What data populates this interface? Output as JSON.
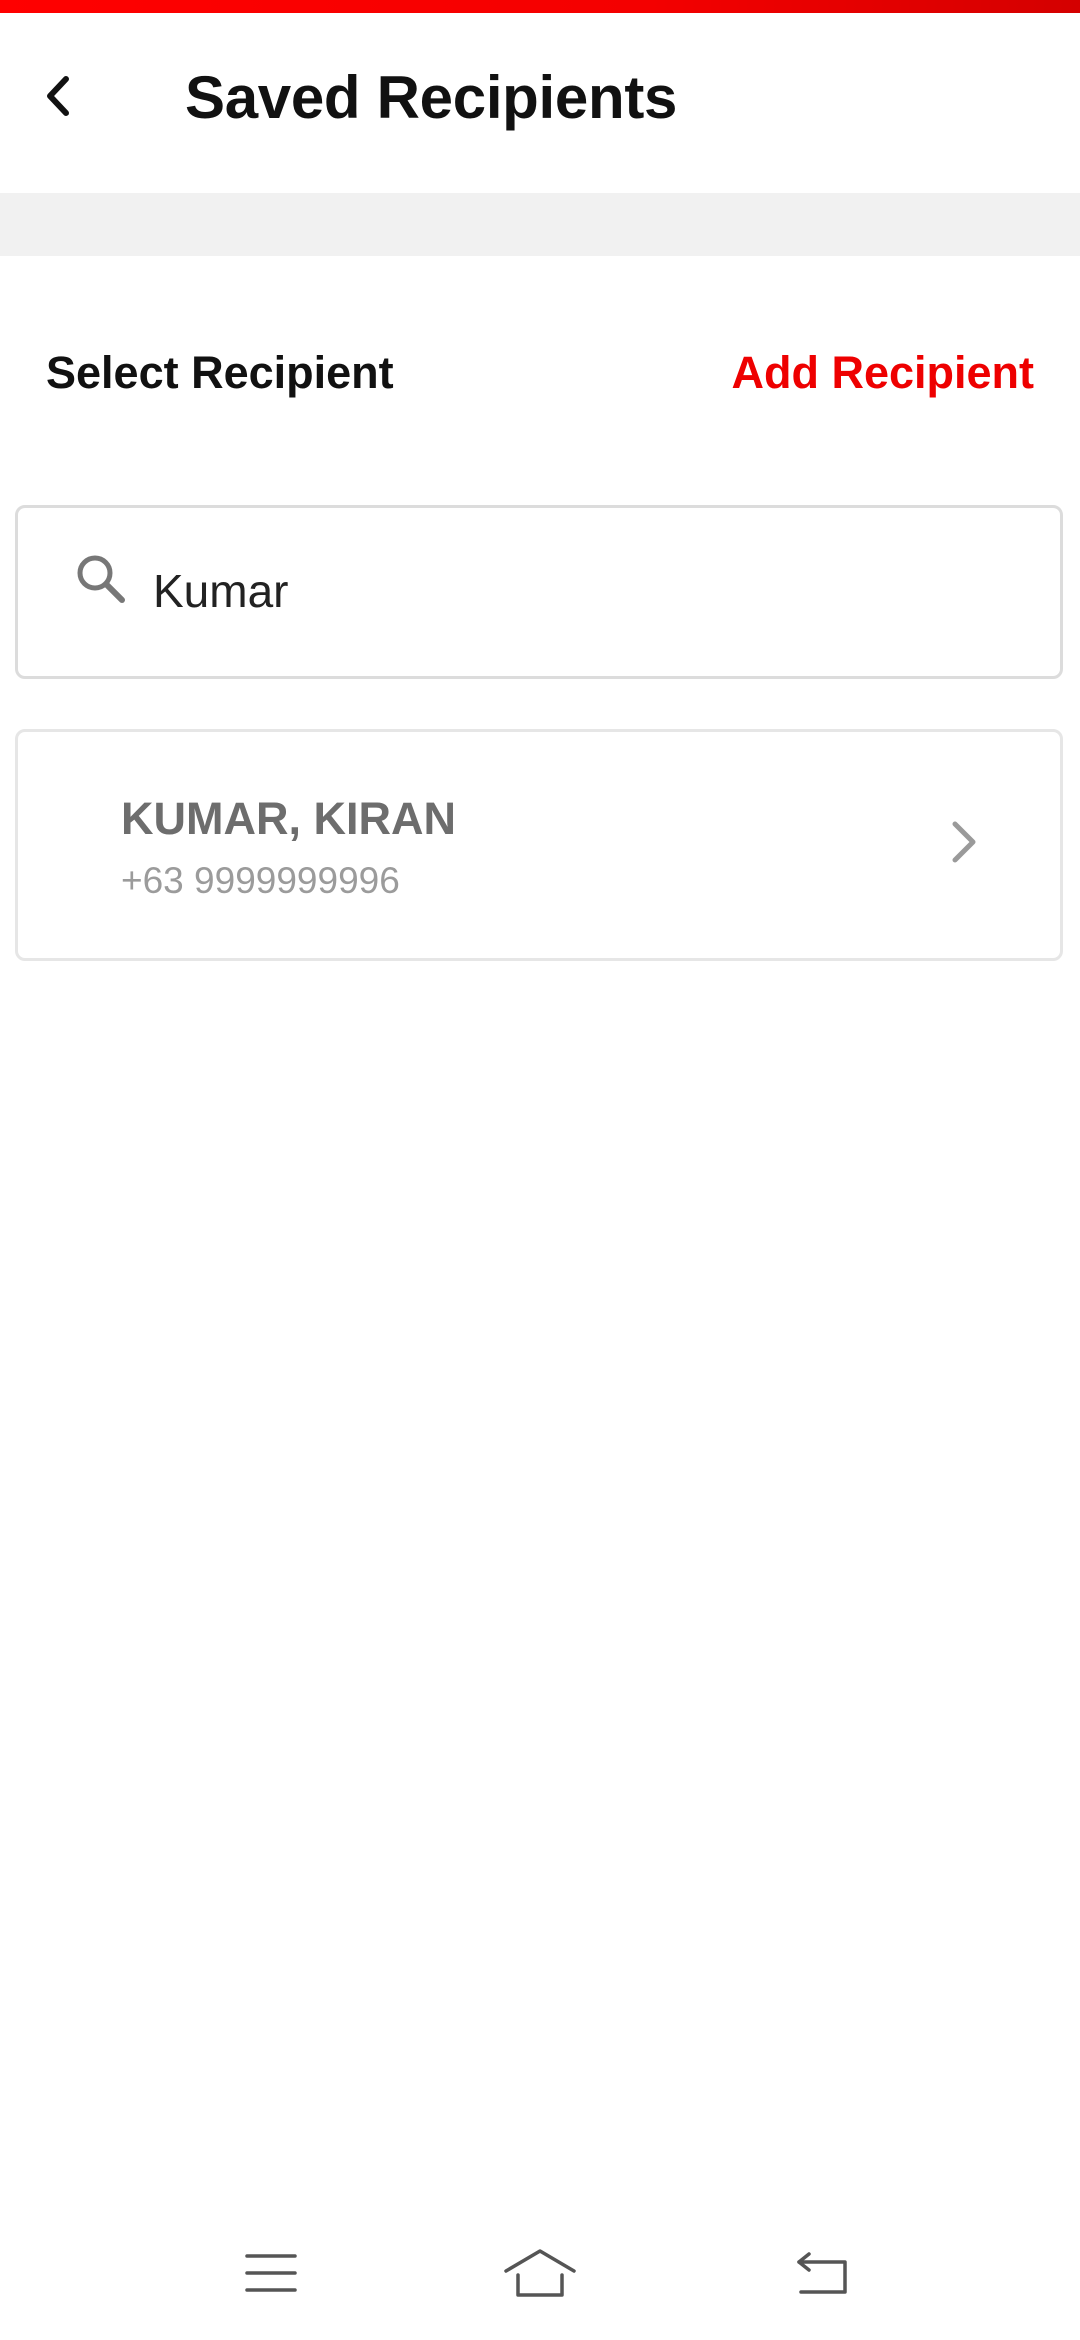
{
  "colors": {
    "accent": "#ee0000",
    "status_strip": "#ff0000",
    "divider_band": "#f1f1f1",
    "title_text": "#111111",
    "recipient_name": "#6d6d6d",
    "recipient_phone": "#9b9b9b"
  },
  "header": {
    "title": "Saved Recipients",
    "back_icon": "chevron-left-icon",
    "badge_icon": "app-logo-icon"
  },
  "section": {
    "label": "Select Recipient",
    "add_link": "Add Recipient"
  },
  "search": {
    "icon": "search-icon",
    "value": "Kumar"
  },
  "recipients": [
    {
      "name": "KUMAR, KIRAN",
      "phone": "+63 9999999996",
      "icon": "chevron-right-icon"
    }
  ],
  "nav": {
    "menu_icon": "menu-icon",
    "home_icon": "home-icon",
    "back_icon": "back-arrow-icon"
  }
}
